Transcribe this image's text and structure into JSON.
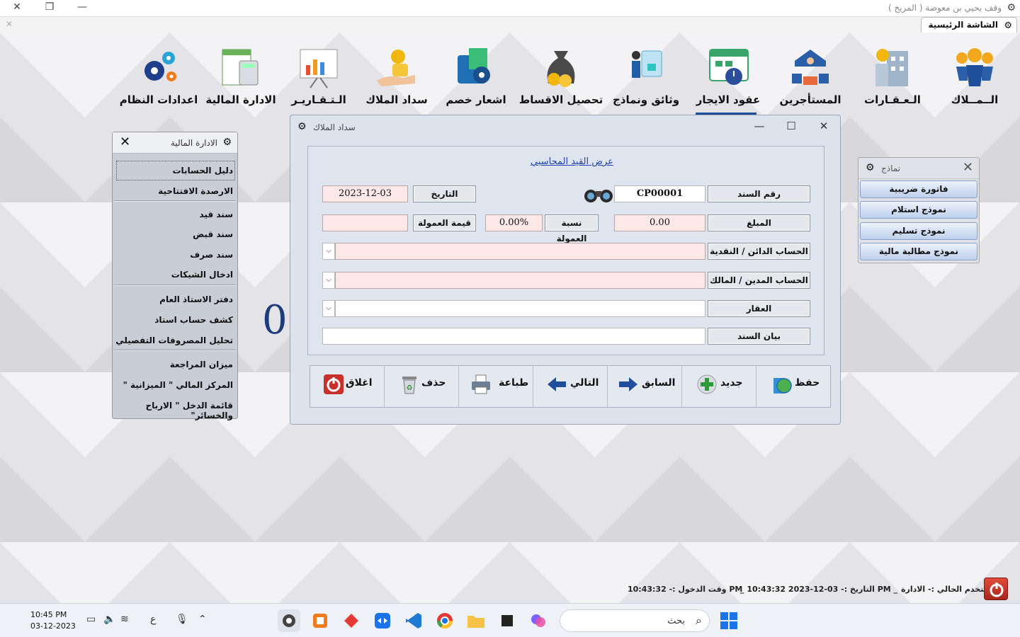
{
  "window": {
    "title": "وقف يحيي بن معوضة ( المريخ )",
    "main_tab": "الشاشة الرئيسية"
  },
  "top_menu": [
    {
      "label": "اعدادات النظام"
    },
    {
      "label": "الادارة المالية"
    },
    {
      "label": "الـتـقـاريـر"
    },
    {
      "label": "سداد الملاك"
    },
    {
      "label": "اشعار خصم"
    },
    {
      "label": "تحصيل الاقساط"
    },
    {
      "label": "وثائق ونماذج"
    },
    {
      "label": "عقود الايجار"
    },
    {
      "label": "المستأجرين"
    },
    {
      "label": "الـعـقـارات"
    },
    {
      "label": "الــمــلاك"
    }
  ],
  "fin_panel": {
    "title": "الادارة المالية",
    "items": [
      "دليل الحسابات",
      "الارصدة الافتتاحية",
      "سند قيد",
      "سند قبض",
      "سند صرف",
      "ادخال الشيكات",
      "دفتر الاستاذ العام",
      "كشف حساب استاذ",
      "تحليل المصروفات التفصيلي",
      "ميزان المراجعة",
      "المركز المالي \" الميزانية \"",
      "قائمة الدخل \" الارباح والخسائر\""
    ]
  },
  "models_panel": {
    "title": "نماذج",
    "buttons": [
      "فاتورة ضريبية",
      "نموذج استلام",
      "نموذج تسليم",
      "نموذج مطالبة مالية"
    ]
  },
  "background_number": "00",
  "dialog": {
    "title": "سداد الملاك",
    "link": "عرض القيد المحاسبي",
    "voucher_no_label": "رقم السند",
    "voucher_no": "CP00001",
    "date_label": "التاريخ",
    "date": "2023-12-03",
    "amount_label": "المبلغ",
    "amount": "0.00",
    "commission_rate_label": "نسبة العمولة",
    "commission_rate": "0.00%",
    "commission_value_label": "قيمة العمولة",
    "commission_value": "",
    "credit_account_label": "الحساب الدائن / النقدية",
    "credit_account": "",
    "debit_account_label": "الحساب المدين / المالك",
    "debit_account": "",
    "property_label": "العقار",
    "property": "",
    "statement_label": "بيان السند",
    "statement": ""
  },
  "toolbar": {
    "save": "حفظ",
    "new": "جديد",
    "previous": "السابق",
    "next": "التالي",
    "print": "طباعة",
    "delete": "حذف",
    "close": "اغلاق"
  },
  "status": {
    "current_user": "المستخدم الحالي :- الادارة",
    "date_time": "_ التاريخ :- 03-12-2023 10:43:32 PM _",
    "login_time": "وقت الدخول :- 10:43:32 PM"
  },
  "taskbar": {
    "time": "10:45 PM",
    "date": "03-12-2023",
    "lang": "ع",
    "search_placeholder": "بحث"
  },
  "colors": {
    "accent": "#1f4e9a",
    "field_pink": "#fde8e8",
    "panel_bg": "#c9cdd4"
  }
}
